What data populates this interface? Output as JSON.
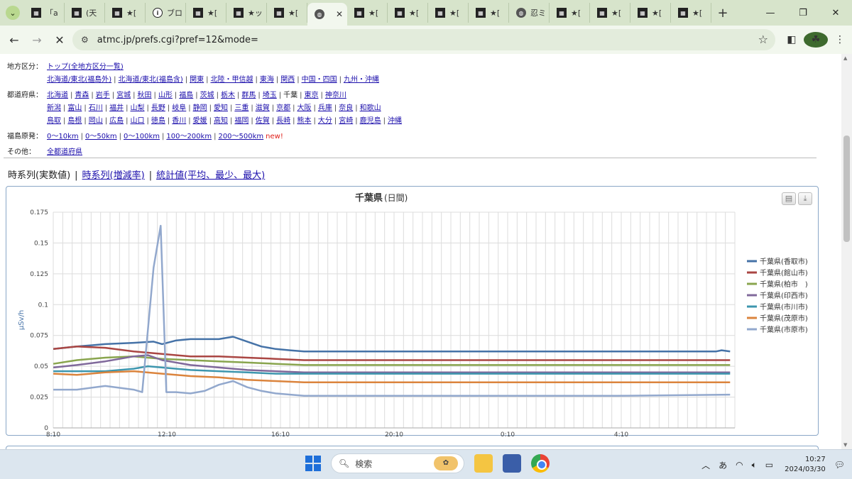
{
  "browser": {
    "tabs": [
      {
        "label": "「a",
        "icon": "site-favicon-icon"
      },
      {
        "label": "(天",
        "icon": "site-favicon-icon"
      },
      {
        "label": "★[",
        "icon": "site-favicon-icon"
      },
      {
        "label": "ブロ",
        "icon": "info-icon"
      },
      {
        "label": "★[",
        "icon": "site-favicon-icon"
      },
      {
        "label": "★ッ",
        "icon": "site-favicon-icon"
      },
      {
        "label": "★[",
        "icon": "site-favicon-icon"
      },
      {
        "label": "",
        "icon": "globe-icon",
        "active": true
      },
      {
        "label": "★[",
        "icon": "site-favicon-icon"
      },
      {
        "label": "★[",
        "icon": "site-favicon-icon"
      },
      {
        "label": "★[",
        "icon": "site-favicon-icon"
      },
      {
        "label": "★[",
        "icon": "site-favicon-icon"
      },
      {
        "label": "忍ミ",
        "icon": "globe-icon"
      },
      {
        "label": "★[",
        "icon": "site-favicon-icon"
      },
      {
        "label": "★[",
        "icon": "site-favicon-icon"
      },
      {
        "label": "★[",
        "icon": "site-favicon-icon"
      },
      {
        "label": "★[",
        "icon": "site-favicon-icon"
      }
    ],
    "url": "atmc.jp/prefs.cgi?pref=12&mode="
  },
  "nav": {
    "region_label": "地方区分：",
    "region_links": [
      "トップ(全地方区分一覧)"
    ],
    "region_links2": [
      "北海道/東北(福島外)",
      "北海道/東北(福島含)",
      "関東",
      "北陸・甲信越",
      "東海",
      "関西",
      "中国・四国",
      "九州・沖縄"
    ],
    "pref_label": "都道府県：",
    "pref_row1": [
      "北海道",
      "青森",
      "岩手",
      "宮城",
      "秋田",
      "山形",
      "福島",
      "茨城",
      "栃木",
      "群馬",
      "埼玉",
      "千葉",
      "東京",
      "神奈川"
    ],
    "pref_row2": [
      "新潟",
      "富山",
      "石川",
      "福井",
      "山梨",
      "長野",
      "岐阜",
      "静岡",
      "愛知",
      "三重",
      "滋賀",
      "京都",
      "大阪",
      "兵庫",
      "奈良",
      "和歌山"
    ],
    "pref_row3": [
      "鳥取",
      "島根",
      "岡山",
      "広島",
      "山口",
      "徳島",
      "香川",
      "愛媛",
      "高知",
      "福岡",
      "佐賀",
      "長崎",
      "熊本",
      "大分",
      "宮崎",
      "鹿児島",
      "沖縄"
    ],
    "current_pref": "千葉",
    "fukushima_label": "福島原発：",
    "fukushima_links": [
      "0～10km",
      "0～50km",
      "0～100km",
      "100～200km",
      "200～500km"
    ],
    "new_mark": "new!",
    "other_label": "その他：",
    "other_links": [
      "全都道府県"
    ]
  },
  "view_tabs": {
    "current": "時系列(実数値)",
    "links": [
      "時系列(増減率)",
      "統計値(平均、最少、最大)"
    ]
  },
  "chart_data": {
    "type": "line",
    "title": "千葉県",
    "subtitle": "(日間)",
    "ylabel": "µSv/h",
    "ylim": [
      0,
      0.175
    ],
    "yticks": [
      0,
      0.025,
      0.05,
      0.075,
      0.1,
      0.125,
      0.15,
      0.175
    ],
    "ytick_labels": [
      "0",
      "0.025",
      "0.05",
      "0.075",
      "0.1",
      "0.125",
      "0.15",
      "0.175"
    ],
    "x_hours_range": [
      8.1667,
      32.1667
    ],
    "xticks": [
      8.1667,
      12.1667,
      16.1667,
      20.1667,
      24.1667,
      28.1667
    ],
    "xtick_labels": [
      "8:10",
      "12:10",
      "16:10",
      "20:10",
      "0:10",
      "4:10"
    ],
    "grid": true,
    "legend": "right",
    "series": [
      {
        "name": "千葉県(香取市)",
        "color": "#4572a7",
        "points": [
          [
            8.17,
            0.064
          ],
          [
            9,
            0.066
          ],
          [
            10,
            0.068
          ],
          [
            11,
            0.069
          ],
          [
            11.7,
            0.07
          ],
          [
            12,
            0.068
          ],
          [
            12.5,
            0.071
          ],
          [
            13,
            0.072
          ],
          [
            14,
            0.072
          ],
          [
            14.5,
            0.074
          ],
          [
            15,
            0.07
          ],
          [
            15.5,
            0.066
          ],
          [
            16,
            0.064
          ],
          [
            16.5,
            0.063
          ],
          [
            17,
            0.062
          ],
          [
            20,
            0.062
          ],
          [
            24,
            0.062
          ],
          [
            28,
            0.062
          ],
          [
            31.5,
            0.062
          ],
          [
            31.7,
            0.063
          ],
          [
            32,
            0.062
          ]
        ]
      },
      {
        "name": "千葉県(館山市)",
        "color": "#aa4643",
        "points": [
          [
            8.17,
            0.064
          ],
          [
            9,
            0.066
          ],
          [
            10,
            0.065
          ],
          [
            11,
            0.062
          ],
          [
            12,
            0.06
          ],
          [
            13,
            0.058
          ],
          [
            14,
            0.058
          ],
          [
            15,
            0.057
          ],
          [
            16,
            0.056
          ],
          [
            17,
            0.055
          ],
          [
            20,
            0.055
          ],
          [
            24,
            0.055
          ],
          [
            28,
            0.055
          ],
          [
            32,
            0.055
          ]
        ]
      },
      {
        "name": "千葉県(柏市　)",
        "color": "#89a54e",
        "points": [
          [
            8.17,
            0.052
          ],
          [
            9,
            0.055
          ],
          [
            10,
            0.057
          ],
          [
            11,
            0.058
          ],
          [
            12,
            0.056
          ],
          [
            13,
            0.055
          ],
          [
            14,
            0.054
          ],
          [
            15,
            0.053
          ],
          [
            16,
            0.052
          ],
          [
            17,
            0.051
          ],
          [
            20,
            0.051
          ],
          [
            24,
            0.051
          ],
          [
            28,
            0.051
          ],
          [
            32,
            0.051
          ]
        ]
      },
      {
        "name": "千葉県(印西市)",
        "color": "#80699b",
        "points": [
          [
            8.17,
            0.049
          ],
          [
            9,
            0.051
          ],
          [
            10,
            0.054
          ],
          [
            11,
            0.058
          ],
          [
            11.5,
            0.059
          ],
          [
            12,
            0.055
          ],
          [
            13,
            0.051
          ],
          [
            14,
            0.049
          ],
          [
            15,
            0.047
          ],
          [
            16,
            0.046
          ],
          [
            17,
            0.045
          ],
          [
            20,
            0.045
          ],
          [
            24,
            0.045
          ],
          [
            28,
            0.045
          ],
          [
            32,
            0.045
          ]
        ]
      },
      {
        "name": "千葉県(市川市)",
        "color": "#3d96ae",
        "points": [
          [
            8.17,
            0.046
          ],
          [
            9,
            0.046
          ],
          [
            10,
            0.046
          ],
          [
            11,
            0.048
          ],
          [
            11.5,
            0.05
          ],
          [
            12,
            0.049
          ],
          [
            13,
            0.047
          ],
          [
            14,
            0.046
          ],
          [
            15,
            0.045
          ],
          [
            16,
            0.044
          ],
          [
            17,
            0.044
          ],
          [
            20,
            0.044
          ],
          [
            24,
            0.044
          ],
          [
            28,
            0.044
          ],
          [
            32,
            0.044
          ]
        ]
      },
      {
        "name": "千葉県(茂原市)",
        "color": "#db843d",
        "points": [
          [
            8.17,
            0.044
          ],
          [
            9,
            0.043
          ],
          [
            10,
            0.045
          ],
          [
            11,
            0.046
          ],
          [
            12,
            0.044
          ],
          [
            13,
            0.042
          ],
          [
            14,
            0.041
          ],
          [
            15,
            0.039
          ],
          [
            16,
            0.038
          ],
          [
            17,
            0.037
          ],
          [
            20,
            0.037
          ],
          [
            24,
            0.037
          ],
          [
            28,
            0.037
          ],
          [
            32,
            0.037
          ]
        ]
      },
      {
        "name": "千葉県(市原市)",
        "color": "#92a8cd",
        "points": [
          [
            8.17,
            0.031
          ],
          [
            9,
            0.031
          ],
          [
            10,
            0.034
          ],
          [
            11,
            0.031
          ],
          [
            11.3,
            0.029
          ],
          [
            11.7,
            0.13
          ],
          [
            11.95,
            0.164
          ],
          [
            12.15,
            0.029
          ],
          [
            12.5,
            0.029
          ],
          [
            13,
            0.028
          ],
          [
            13.5,
            0.03
          ],
          [
            14,
            0.035
          ],
          [
            14.5,
            0.038
          ],
          [
            15,
            0.033
          ],
          [
            15.5,
            0.03
          ],
          [
            16,
            0.028
          ],
          [
            17,
            0.026
          ],
          [
            20,
            0.026
          ],
          [
            24,
            0.026
          ],
          [
            28,
            0.026
          ],
          [
            32,
            0.027
          ]
        ]
      }
    ]
  },
  "taskbar": {
    "search_placeholder": "検索",
    "ime": "あ",
    "time": "10:27",
    "date": "2024/03/30"
  }
}
